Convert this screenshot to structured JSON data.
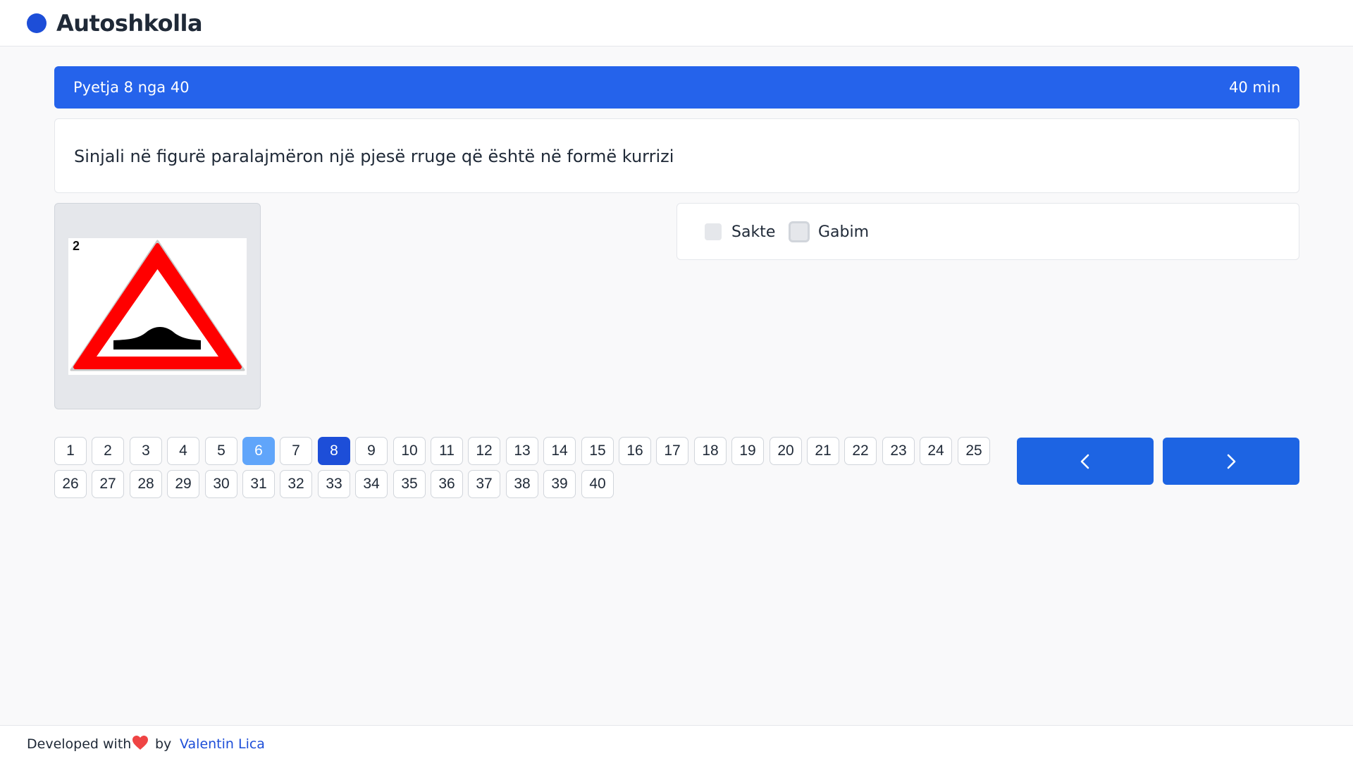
{
  "app": {
    "title": "Autoshkolla"
  },
  "quiz": {
    "counter": "Pyetja 8 nga 40",
    "timer": "40 min",
    "question": "Sinjali në figurë paralajmëron një pjesë rruge që është në formë kurrizi",
    "image": {
      "sign_number": "2",
      "icon": "speed-bump-warning-sign"
    },
    "options": [
      {
        "label": "Sakte"
      },
      {
        "label": "Gabim"
      }
    ]
  },
  "pagination": {
    "pages": [
      "1",
      "2",
      "3",
      "4",
      "5",
      "6",
      "7",
      "8",
      "9",
      "10",
      "11",
      "12",
      "13",
      "14",
      "15",
      "16",
      "17",
      "18",
      "19",
      "20",
      "21",
      "22",
      "23",
      "24",
      "25",
      "26",
      "27",
      "28",
      "29",
      "30",
      "31",
      "32",
      "33",
      "34",
      "35",
      "36",
      "37",
      "38",
      "39",
      "40"
    ],
    "current": "8",
    "visited": [
      "6"
    ],
    "prev_icon": "chevron-left-icon",
    "next_icon": "chevron-right-icon"
  },
  "footer": {
    "text": "Developed with",
    "icon": "heart-icon",
    "by": "by",
    "author": "Valentin Lica"
  },
  "colors": {
    "primary": "#2563eb",
    "current_page": "#1d4ed8",
    "visited_page": "#60a5fa",
    "heart": "#ef4444"
  }
}
